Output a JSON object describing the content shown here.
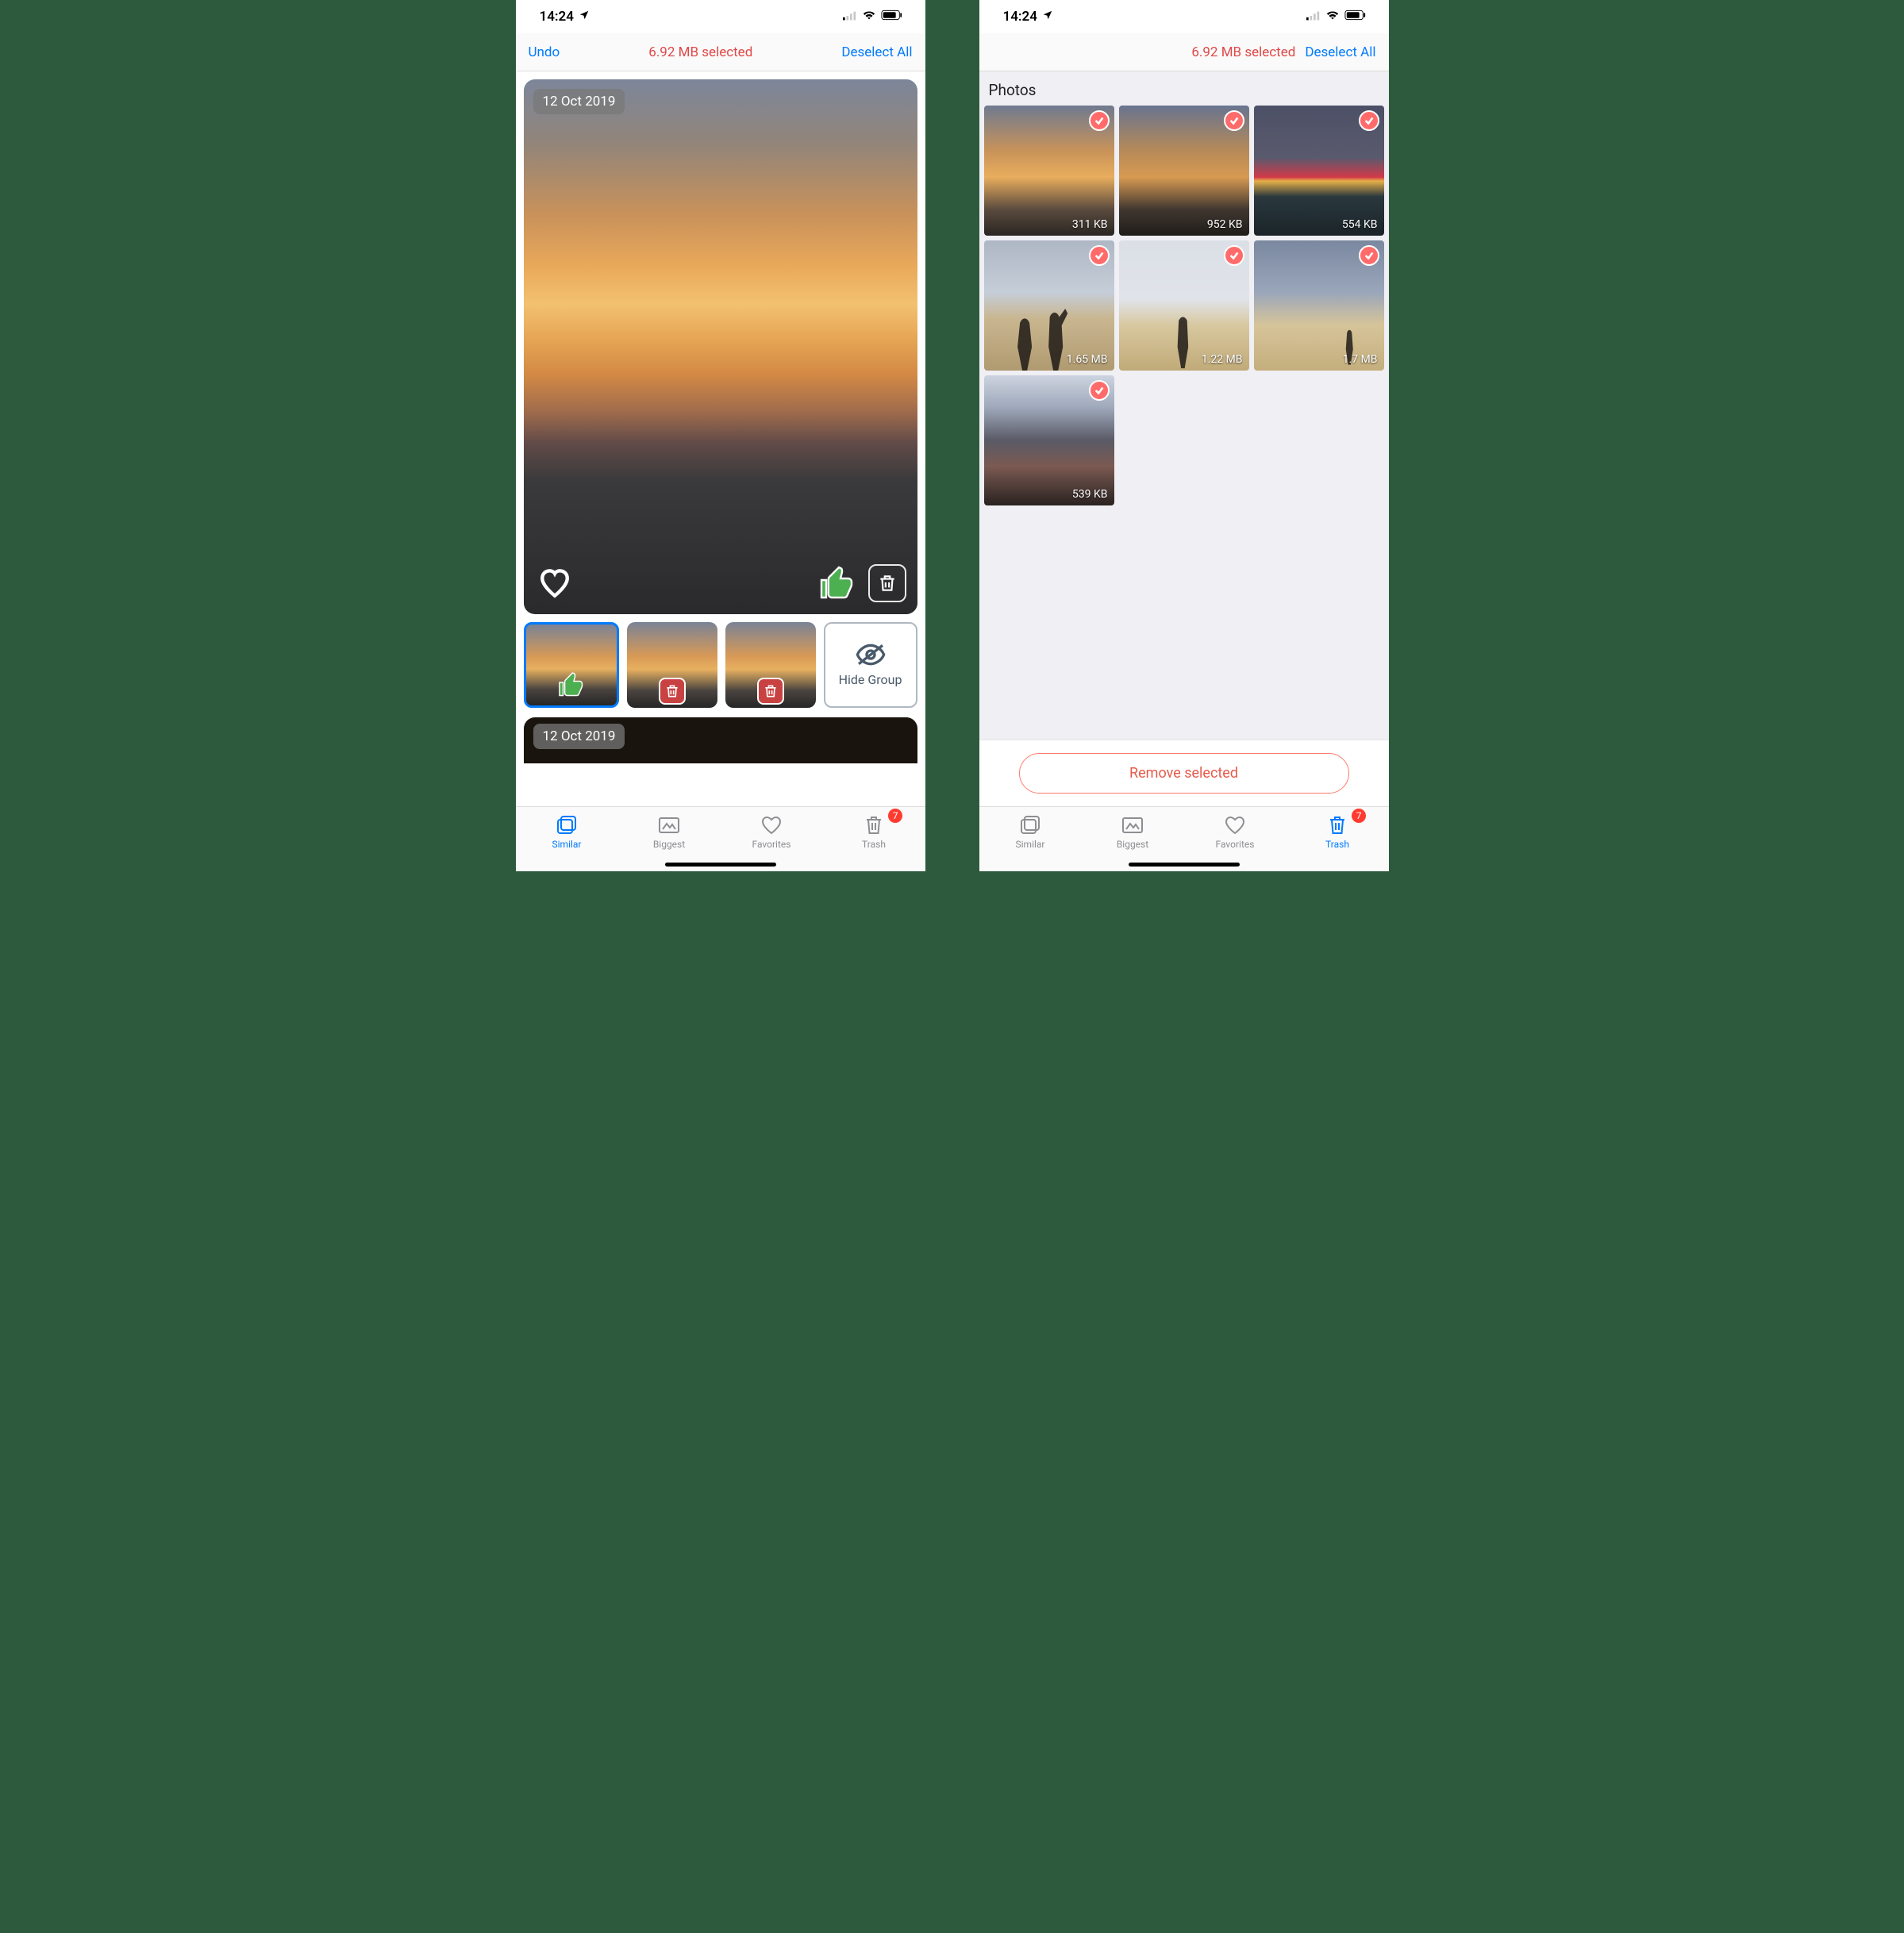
{
  "status": {
    "time": "14:24"
  },
  "nav": {
    "undo": "Undo",
    "selected": "6.92 MB selected",
    "deselect": "Deselect All"
  },
  "left": {
    "group_date": "12 Oct 2019",
    "hide_group": "Hide Group",
    "peek_date": "12 Oct 2019"
  },
  "right": {
    "section": "Photos",
    "remove": "Remove selected",
    "items": [
      {
        "size": "311 KB"
      },
      {
        "size": "952 KB"
      },
      {
        "size": "554 KB"
      },
      {
        "size": "1.65 MB"
      },
      {
        "size": "1.22 MB"
      },
      {
        "size": "1.7 MB"
      },
      {
        "size": "539 KB"
      }
    ]
  },
  "tabs": {
    "similar": "Similar",
    "biggest": "Biggest",
    "favorites": "Favorites",
    "trash": "Trash",
    "trash_badge": "7"
  }
}
